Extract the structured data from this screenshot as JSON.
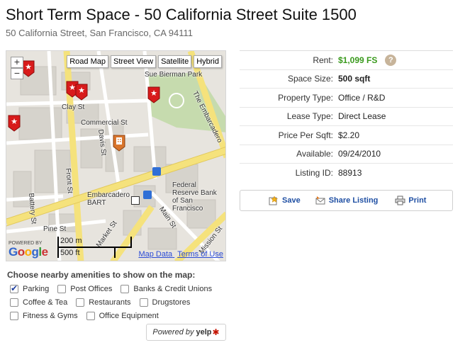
{
  "header": {
    "title": "Short Term Space - 50 California Street Suite 1500",
    "address": "50 California Street, San Francisco, CA 94111"
  },
  "map": {
    "controls": {
      "zoom_in": "+",
      "zoom_out": "−"
    },
    "map_types": [
      "Road Map",
      "Street View",
      "Satellite",
      "Hybrid"
    ],
    "labels": {
      "park": "Sue Bierman Park",
      "embarcadero_road": "The Embarcadero",
      "clay_st": "Clay St",
      "commercial_st": "Commercial St",
      "davis_st": "Davis St",
      "front_st": "Front St",
      "battery_st": "Battery St",
      "pine_st": "Pine St",
      "market_st": "Market St",
      "main_st": "Main St",
      "mission_st": "Mission St",
      "embarcadero_bart": "Embarcadero BART",
      "federal_reserve": "Federal Reserve Bank of San Francisco"
    },
    "powered_by": "POWERED BY",
    "google": [
      "G",
      "o",
      "o",
      "g",
      "l",
      "e"
    ],
    "scale_metric": "200 m",
    "scale_imperial": "500 ft",
    "map_data": "Map Data",
    "terms": "Terms of Use",
    "marker_icon": "red-star-pin-icon",
    "building_icon": "orange-building-pin-icon"
  },
  "details": {
    "rows": [
      {
        "label": "Rent:",
        "value": "$1,099 FS"
      },
      {
        "label": "Space Size:",
        "value": "500 sqft"
      },
      {
        "label": "Property Type:",
        "value": "Office / R&D"
      },
      {
        "label": "Lease Type:",
        "value": "Direct Lease"
      },
      {
        "label": "Price Per Sqft:",
        "value": "$2.20"
      },
      {
        "label": "Available:",
        "value": "09/24/2010"
      },
      {
        "label": "Listing ID:",
        "value": "88913"
      }
    ],
    "help_glyph": "?"
  },
  "actions": {
    "save": "Save",
    "share": "Share Listing",
    "print": "Print"
  },
  "amenities": {
    "title": "Choose nearby amenities to show on the map:",
    "items": [
      {
        "label": "Parking",
        "checked": true
      },
      {
        "label": "Post Offices",
        "checked": false
      },
      {
        "label": "Banks & Credit Unions",
        "checked": false
      },
      {
        "label": "Coffee & Tea",
        "checked": false
      },
      {
        "label": "Restaurants",
        "checked": false
      },
      {
        "label": "Drugstores",
        "checked": false
      },
      {
        "label": "Fitness & Gyms",
        "checked": false
      },
      {
        "label": "Office Equipment",
        "checked": false
      }
    ]
  },
  "yelp": {
    "powered_by": "Powered by",
    "brand": "yelp",
    "burst": "✱"
  },
  "colors": {
    "rent_green": "#3a9a1d",
    "link_blue": "#1f4fa3",
    "road_yellow": "#f6e27a",
    "pin_red": "#d81b1b"
  }
}
